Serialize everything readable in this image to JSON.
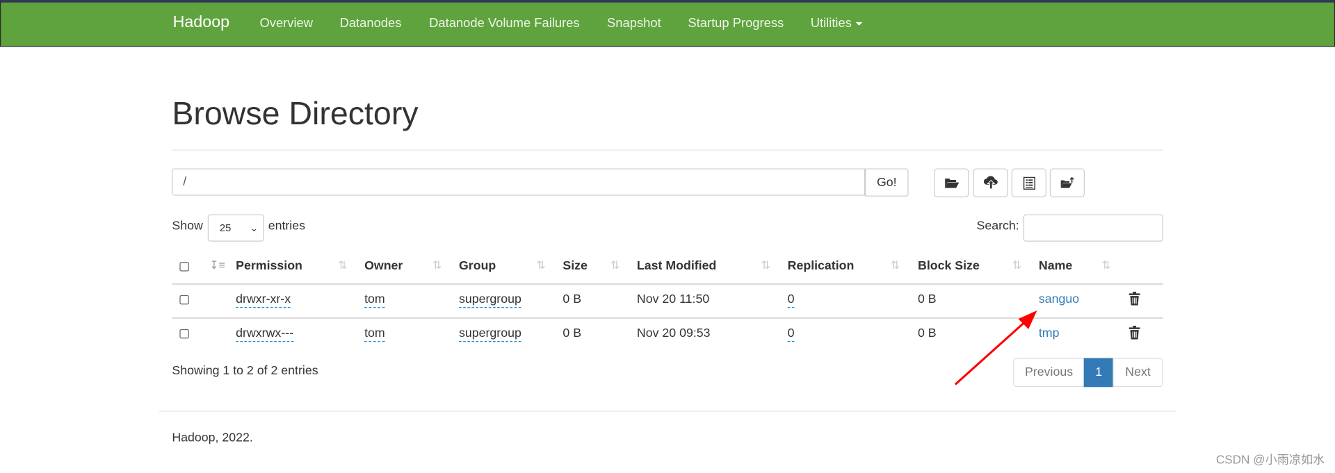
{
  "navbar": {
    "brand": "Hadoop",
    "items": [
      "Overview",
      "Datanodes",
      "Datanode Volume Failures",
      "Snapshot",
      "Startup Progress",
      "Utilities"
    ],
    "color": "#5fa33e"
  },
  "page": {
    "title": "Browse Directory"
  },
  "path": {
    "value": "/",
    "go_label": "Go!"
  },
  "toolbar": {
    "icons": [
      "folder-open-icon",
      "cloud-upload-icon",
      "list-alt-icon",
      "folder-move-icon"
    ]
  },
  "table_controls": {
    "show_label": "Show",
    "page_size": "25",
    "entries_label": "entries",
    "search_label": "Search:",
    "search_value": ""
  },
  "table": {
    "columns": [
      "Permission",
      "Owner",
      "Group",
      "Size",
      "Last Modified",
      "Replication",
      "Block Size",
      "Name"
    ],
    "rows": [
      {
        "permission": "drwxr-xr-x",
        "owner": "tom",
        "group": "supergroup",
        "size": "0 B",
        "modified": "Nov 20 11:50",
        "replication": "0",
        "block_size": "0 B",
        "name": "sanguo"
      },
      {
        "permission": "drwxrwx---",
        "owner": "tom",
        "group": "supergroup",
        "size": "0 B",
        "modified": "Nov 20 09:53",
        "replication": "0",
        "block_size": "0 B",
        "name": "tmp"
      }
    ],
    "info": "Showing 1 to 2 of 2 entries"
  },
  "pagination": {
    "previous": "Previous",
    "current": "1",
    "next": "Next",
    "active_color": "#337ab7"
  },
  "footer": {
    "text": "Hadoop, 2022."
  },
  "watermark": "CSDN @小雨凉如水",
  "annotation": {
    "arrow_color": "#ff0000"
  }
}
